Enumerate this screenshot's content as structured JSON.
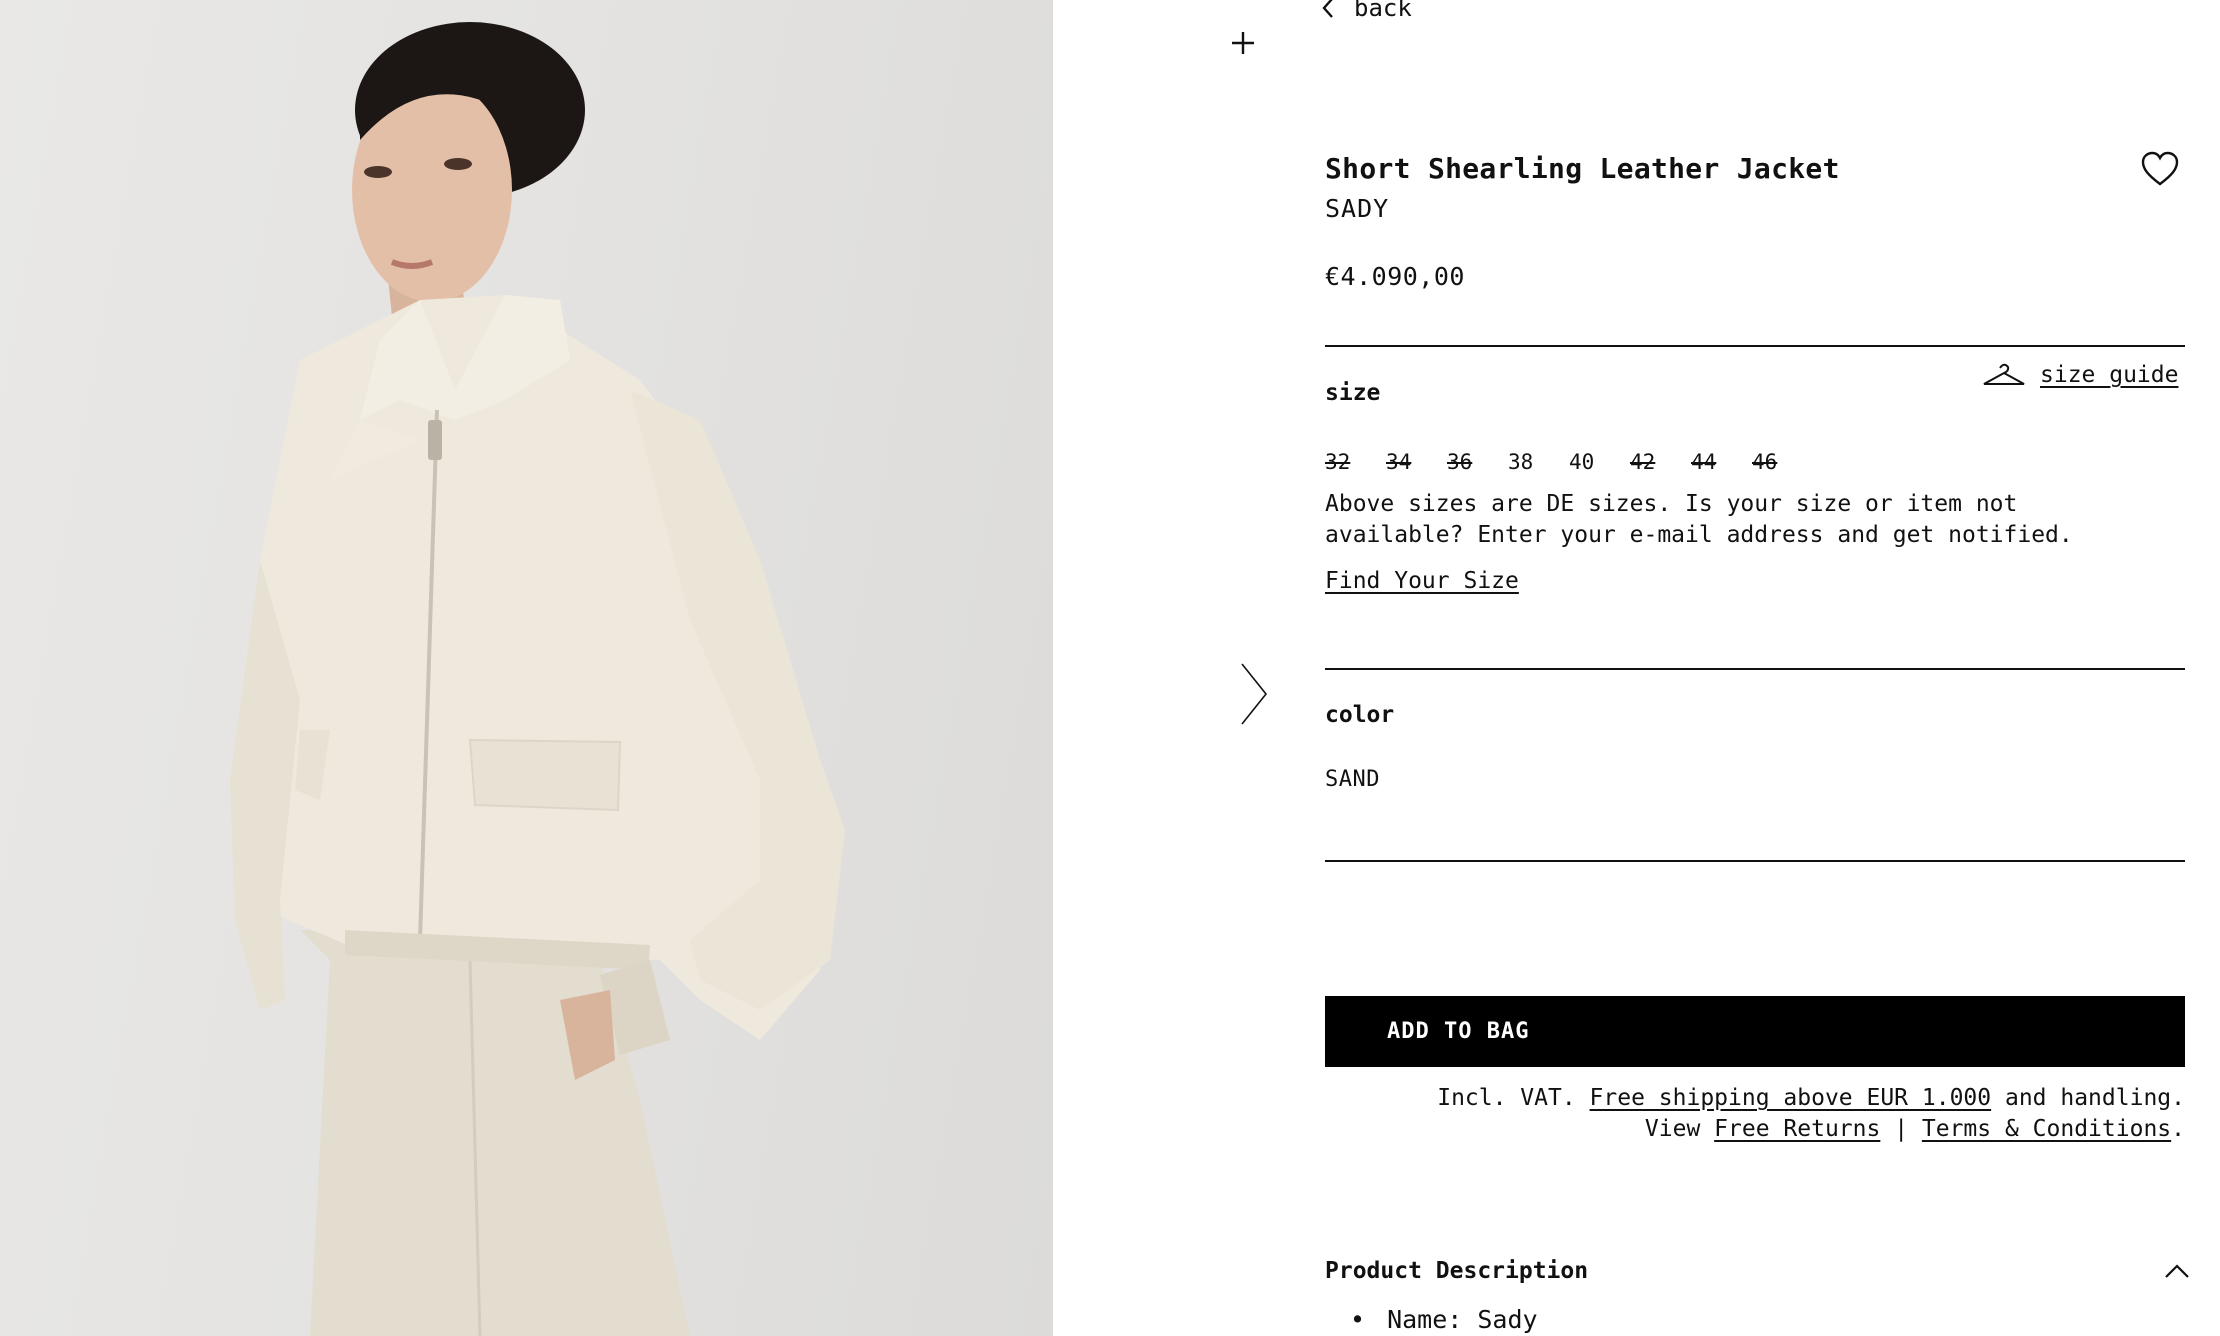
{
  "nav": {
    "back_label": "back"
  },
  "product": {
    "title": "Short Shearling Leather Jacket",
    "brand": "SADY",
    "price": "€4.090,00"
  },
  "size_section": {
    "label": "size",
    "guide_label": "size guide",
    "sizes": [
      {
        "label": "32",
        "available": false
      },
      {
        "label": "34",
        "available": false
      },
      {
        "label": "36",
        "available": false
      },
      {
        "label": "38",
        "available": true
      },
      {
        "label": "40",
        "available": true
      },
      {
        "label": "42",
        "available": false
      },
      {
        "label": "44",
        "available": false
      },
      {
        "label": "46",
        "available": false
      }
    ],
    "note_line1": "Above sizes are DE sizes. Is your size or item not",
    "note_line2": "available? Enter your e-mail address and get notified.",
    "find_link": "Find Your Size"
  },
  "color_section": {
    "label": "color",
    "value": "SAND"
  },
  "cart": {
    "add_label": "ADD TO BAG"
  },
  "shipping": {
    "prefix": "Incl. VAT. ",
    "free_shipping_link": "Free shipping above EUR 1.000",
    "suffix": " and handling.",
    "view_prefix": "View ",
    "returns_link": "Free Returns",
    "separator": " | ",
    "terms_link": "Terms & Conditions",
    "end": "."
  },
  "description": {
    "title": "Product Description",
    "bullet": "•",
    "items": [
      "Name: Sady"
    ]
  },
  "icons": {
    "back": "chevron-left-icon",
    "zoom": "plus-icon",
    "next": "chevron-right-icon",
    "wishlist": "heart-icon",
    "size_guide": "hanger-icon",
    "collapse": "chevron-up-icon"
  },
  "colors": {
    "text": "#111111",
    "button": "#000000",
    "button_text": "#ffffff",
    "background": "#ffffff"
  }
}
